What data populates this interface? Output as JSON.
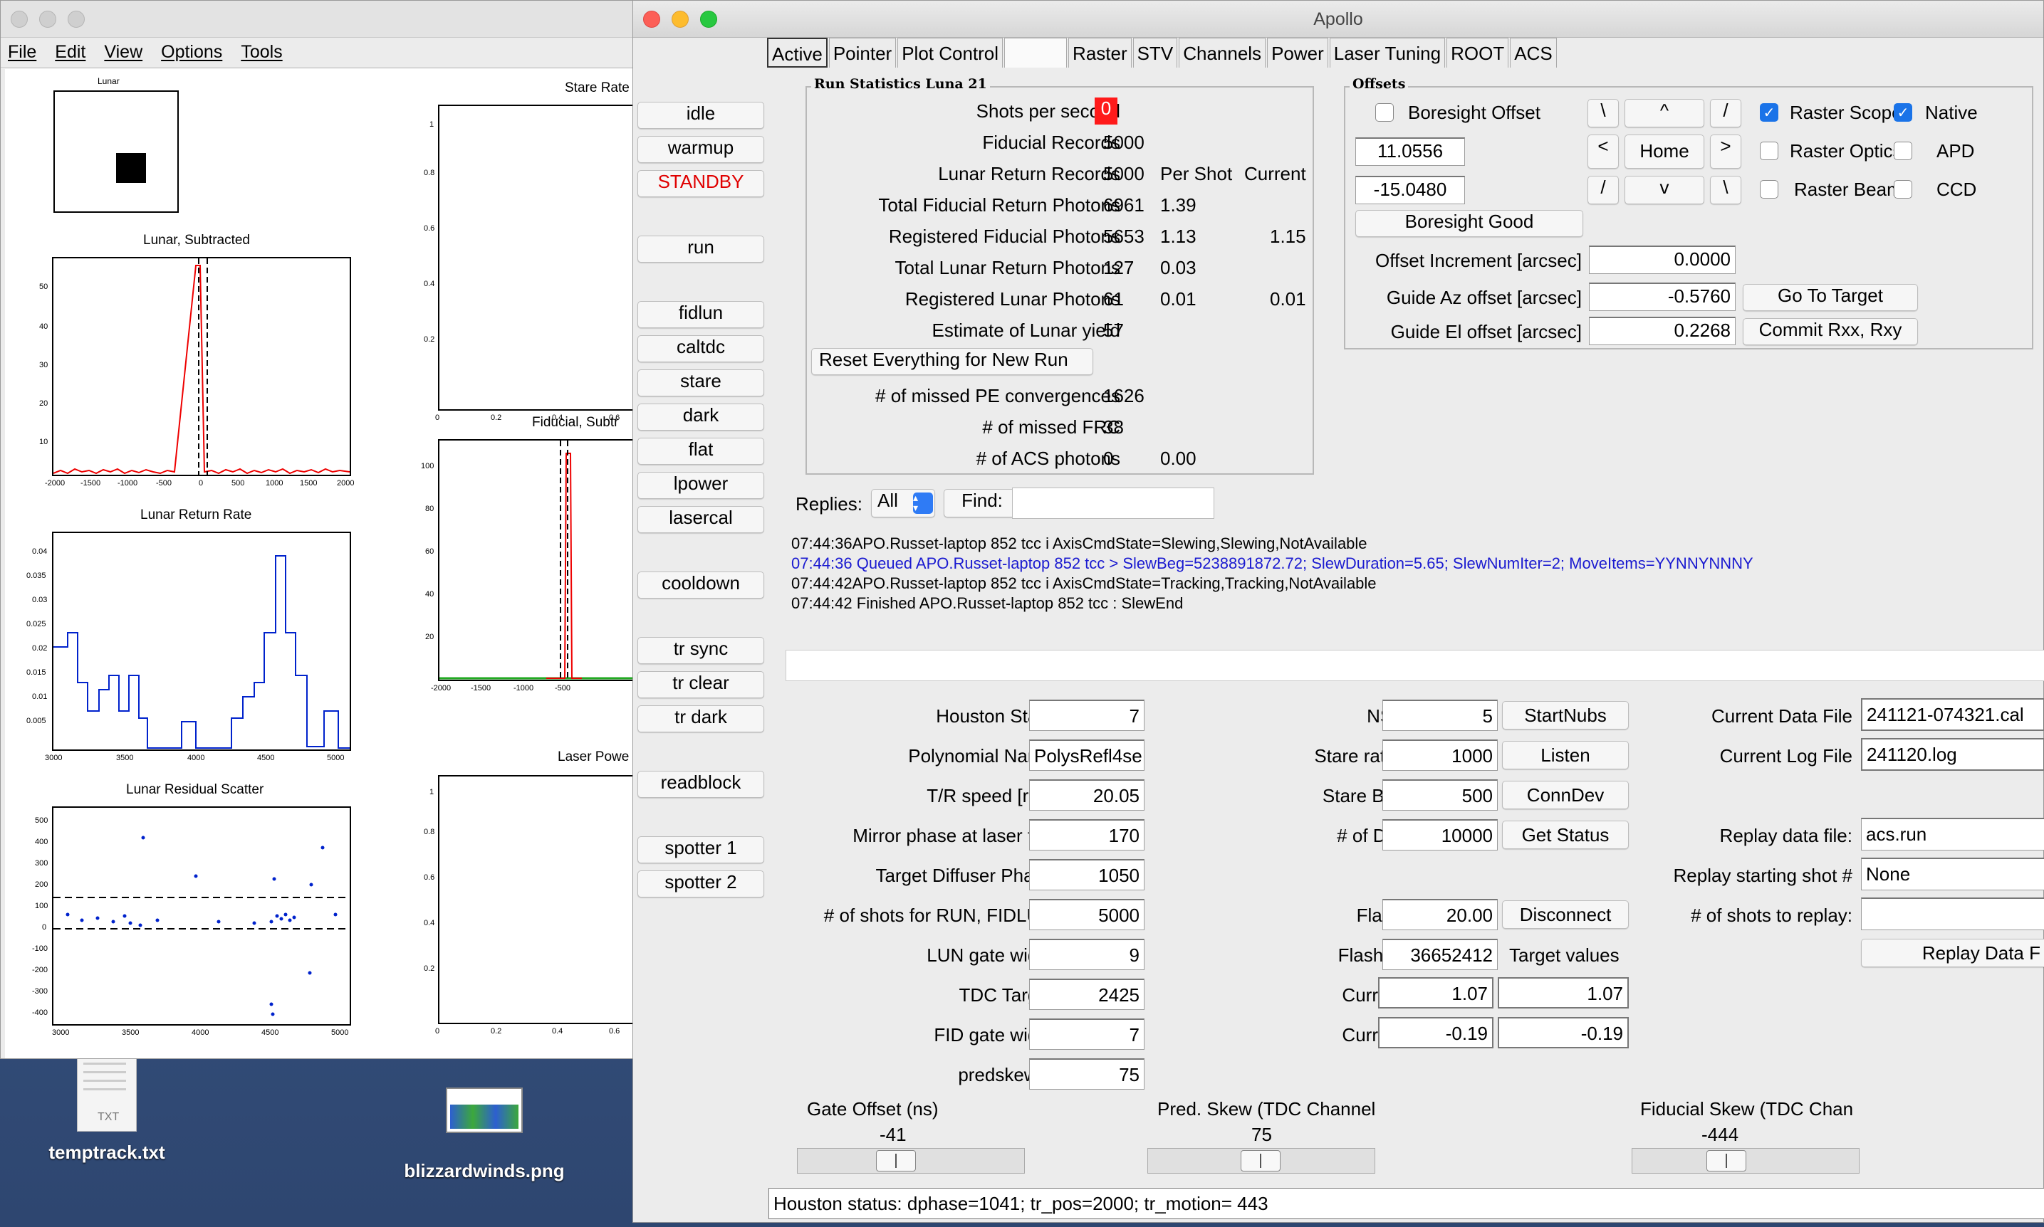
{
  "left_window": {
    "menu": [
      "File",
      "Edit",
      "View",
      "Options",
      "Tools"
    ],
    "plots": {
      "lunar": {
        "title": "Lunar"
      },
      "lunar_subtracted": {
        "title": "Lunar, Subtracted",
        "y_ticks": [
          "50",
          "40",
          "30",
          "20",
          "10"
        ],
        "x_ticks": [
          "-2000",
          "-1500",
          "-1000",
          "-500",
          "0",
          "500",
          "1000",
          "1500",
          "2000"
        ]
      },
      "lunar_return_rate": {
        "title": "Lunar Return Rate",
        "y_ticks": [
          "0.04",
          "0.035",
          "0.03",
          "0.025",
          "0.02",
          "0.015",
          "0.01",
          "0.005"
        ],
        "x_ticks": [
          "3000",
          "3500",
          "4000",
          "4500",
          "5000"
        ]
      },
      "lunar_residual": {
        "title": "Lunar Residual Scatter",
        "y_ticks": [
          "500",
          "400",
          "300",
          "200",
          "100",
          "0",
          "-100",
          "-200",
          "-300",
          "-400"
        ],
        "x_ticks": [
          "3000",
          "3500",
          "4000",
          "4500",
          "5000"
        ]
      },
      "stare_rate": {
        "title": "Stare Rate",
        "y_ticks": [
          "1",
          "0.8",
          "0.6",
          "0.4",
          "0.2",
          "0"
        ],
        "x_ticks": [
          "0",
          "0.2",
          "0.4",
          "0.6"
        ]
      },
      "fiducial_sub": {
        "title": "Fiducial, Subtr",
        "y_ticks": [
          "100",
          "80",
          "60",
          "40",
          "20"
        ],
        "x_ticks": [
          "-2000",
          "-1500",
          "-1000",
          "-500"
        ]
      },
      "laser_power": {
        "title": "Laser Powe",
        "y_ticks": [
          "1",
          "0.8",
          "0.6",
          "0.4",
          "0.2",
          "0"
        ],
        "x_ticks": [
          "0",
          "0.2",
          "0.4",
          "0.6"
        ]
      }
    }
  },
  "app": {
    "title": "Apollo",
    "tabs": [
      "Active",
      "Pointer",
      "Plot Control",
      "",
      "Raster",
      "STV",
      "Channels",
      "Power",
      "Laser Tuning",
      "ROOT",
      "ACS"
    ],
    "side_buttons": [
      {
        "label": "idle",
        "color": "#000"
      },
      {
        "label": "warmup",
        "color": "#000"
      },
      {
        "label": "STANDBY",
        "color": "#e00000"
      },
      {
        "label": "run",
        "color": "#000"
      },
      {
        "label": "fidlun",
        "color": "#000"
      },
      {
        "label": "caltdc",
        "color": "#000"
      },
      {
        "label": "stare",
        "color": "#000"
      },
      {
        "label": "dark",
        "color": "#000"
      },
      {
        "label": "flat",
        "color": "#000"
      },
      {
        "label": "lpower",
        "color": "#000"
      },
      {
        "label": "lasercal",
        "color": "#000"
      },
      {
        "label": "cooldown",
        "color": "#000"
      },
      {
        "label": "tr sync",
        "color": "#000"
      },
      {
        "label": "tr clear",
        "color": "#000"
      },
      {
        "label": "tr dark",
        "color": "#000"
      },
      {
        "label": "readblock",
        "color": "#000"
      },
      {
        "label": "spotter 1",
        "color": "#000"
      },
      {
        "label": "spotter 2",
        "color": "#000"
      }
    ],
    "run_stats": {
      "title": "Run Statistics Luna 21",
      "shots_label": "Shots per second",
      "shots_value": "0",
      "rows": [
        {
          "label": "Fiducial Records",
          "v1": "5000",
          "v2": "",
          "v3": ""
        },
        {
          "label": "Lunar Return Records",
          "v1": "5000",
          "v2": "Per Shot",
          "v3": "Current"
        },
        {
          "label": "Total Fiducial Return Photons",
          "v1": "6961",
          "v2": "1.39",
          "v3": ""
        },
        {
          "label": "Registered Fiducial Photons",
          "v1": "5653",
          "v2": "1.13",
          "v3": "1.15"
        },
        {
          "label": "Total Lunar Return Photons",
          "v1": "127",
          "v2": "0.03",
          "v3": ""
        },
        {
          "label": "Registered Lunar Photons",
          "v1": "61",
          "v2": "0.01",
          "v3": "0.01"
        },
        {
          "label": "Estimate of Lunar yield",
          "v1": "57",
          "v2": "",
          "v3": ""
        }
      ],
      "reset_label": "Reset Everything for New Run",
      "rows2": [
        {
          "label": "# of missed PE convergences",
          "v1": "1626",
          "v2": ""
        },
        {
          "label": "# of missed FRC",
          "v1": "38",
          "v2": ""
        },
        {
          "label": "# of ACS photons",
          "v1": "0",
          "v2": "0.00"
        }
      ]
    },
    "offsets": {
      "title": "Offsets",
      "boresight_offset": "Boresight Offset",
      "az_value": "11.0556",
      "el_value": "-15.0480",
      "boresight_good": "Boresight Good",
      "nav": {
        "ul": "\\",
        "up": "^",
        "ur": "/",
        "left": "<",
        "home": "Home",
        "right": ">",
        "dl": "/",
        "down": "v",
        "dr": "\\"
      },
      "raster_scope": "Raster Scope",
      "native": "Native",
      "raster_optics": "Raster Optics",
      "apd": "APD",
      "raster_beam": "Raster Beam",
      "ccd": "CCD",
      "offset_increment_label": "Offset Increment [arcsec]",
      "offset_increment": "0.0000",
      "guide_az_label": "Guide Az offset [arcsec]",
      "guide_az": "-0.5760",
      "go_to_target": "Go To Target",
      "guide_el_label": "Guide El offset [arcsec]",
      "guide_el": "0.2268",
      "commit": "Commit Rxx, Rxy"
    },
    "replies": {
      "label": "Replies:",
      "select": "All",
      "find_label": "Find:",
      "find_value": ""
    },
    "log": [
      {
        "text": "07:44:36APO.Russet-laptop 852 tcc i AxisCmdState=Slewing,Slewing,NotAvailable",
        "color": "#000"
      },
      {
        "text": "07:44:36 Queued APO.Russet-laptop 852 tcc > SlewBeg=5238891872.72; SlewDuration=5.65; SlewNumIter=2; MoveItems=YYNNYNNNY",
        "color": "#1a1ad0"
      },
      {
        "text": "07:44:42APO.Russet-laptop 852 tcc i AxisCmdState=Tracking,Tracking,NotAvailable",
        "color": "#000"
      },
      {
        "text": "07:44:42 Finished APO.Russet-laptop 852 tcc : SlewEnd",
        "color": "#000"
      }
    ],
    "col1": [
      {
        "label": "Houston State",
        "value": "7"
      },
      {
        "label": "Polynomial Name",
        "value": "PolysRefl4se"
      },
      {
        "label": "T/R speed [rps]",
        "value": "20.05"
      },
      {
        "label": "Mirror phase at laser fire",
        "value": "170"
      },
      {
        "label": "Target Diffuser Phase",
        "value": "1050"
      },
      {
        "label": "# of shots for RUN, FIDLUN",
        "value": "5000"
      },
      {
        "label": "LUN gate width",
        "value": "9"
      },
      {
        "label": "TDC Target",
        "value": "2425"
      },
      {
        "label": "FID gate width",
        "value": "7"
      },
      {
        "label": "predskew =",
        "value": "75"
      }
    ],
    "col2": [
      {
        "label": "NStares",
        "value": "5",
        "button": "StartNubs"
      },
      {
        "label": "Stare rate [Hz]",
        "value": "1000",
        "button": "Listen"
      },
      {
        "label": "Stare Binning",
        "value": "500",
        "button": "ConnDev"
      },
      {
        "label": "# of DARKs",
        "value": "10000",
        "button": "Get Status"
      },
      {
        "label": "",
        "value": "",
        "button": ""
      },
      {
        "label": "Flashrate",
        "value": "20.00",
        "button": "Disconnect"
      },
      {
        "label": "Flash count",
        "value": "36652412",
        "button": ""
      }
    ],
    "target_values": "Target values",
    "current_rxx": {
      "label": "Current rxx",
      "v1": "1.07",
      "v2": "1.07"
    },
    "current_rxy": {
      "label": "Current rxy",
      "v1": "-0.19",
      "v2": "-0.19"
    },
    "col3": [
      {
        "label": "Current Data File",
        "value": "241121-074321.cal"
      },
      {
        "label": "Current Log File",
        "value": "241120.log"
      },
      {
        "label": "Replay data file:",
        "value": "acs.run"
      },
      {
        "label": "Replay starting shot #",
        "value": "None"
      },
      {
        "label": "# of shots to replay:",
        "value": ""
      }
    ],
    "replay_button": "Replay Data F",
    "sliders": [
      {
        "label": "Gate Offset (ns)",
        "value": "-41"
      },
      {
        "label": "Pred. Skew (TDC Channel",
        "value": "75"
      },
      {
        "label": "Fiducial Skew (TDC Chan",
        "value": "-444"
      }
    ],
    "status": "Houston status: dphase=1041;  tr_pos=2000;  tr_motion= 443"
  },
  "desktop": {
    "icons": [
      {
        "name": "temptrack.txt",
        "badge": "TXT"
      },
      {
        "name": "blizzardwinds.png"
      }
    ]
  }
}
